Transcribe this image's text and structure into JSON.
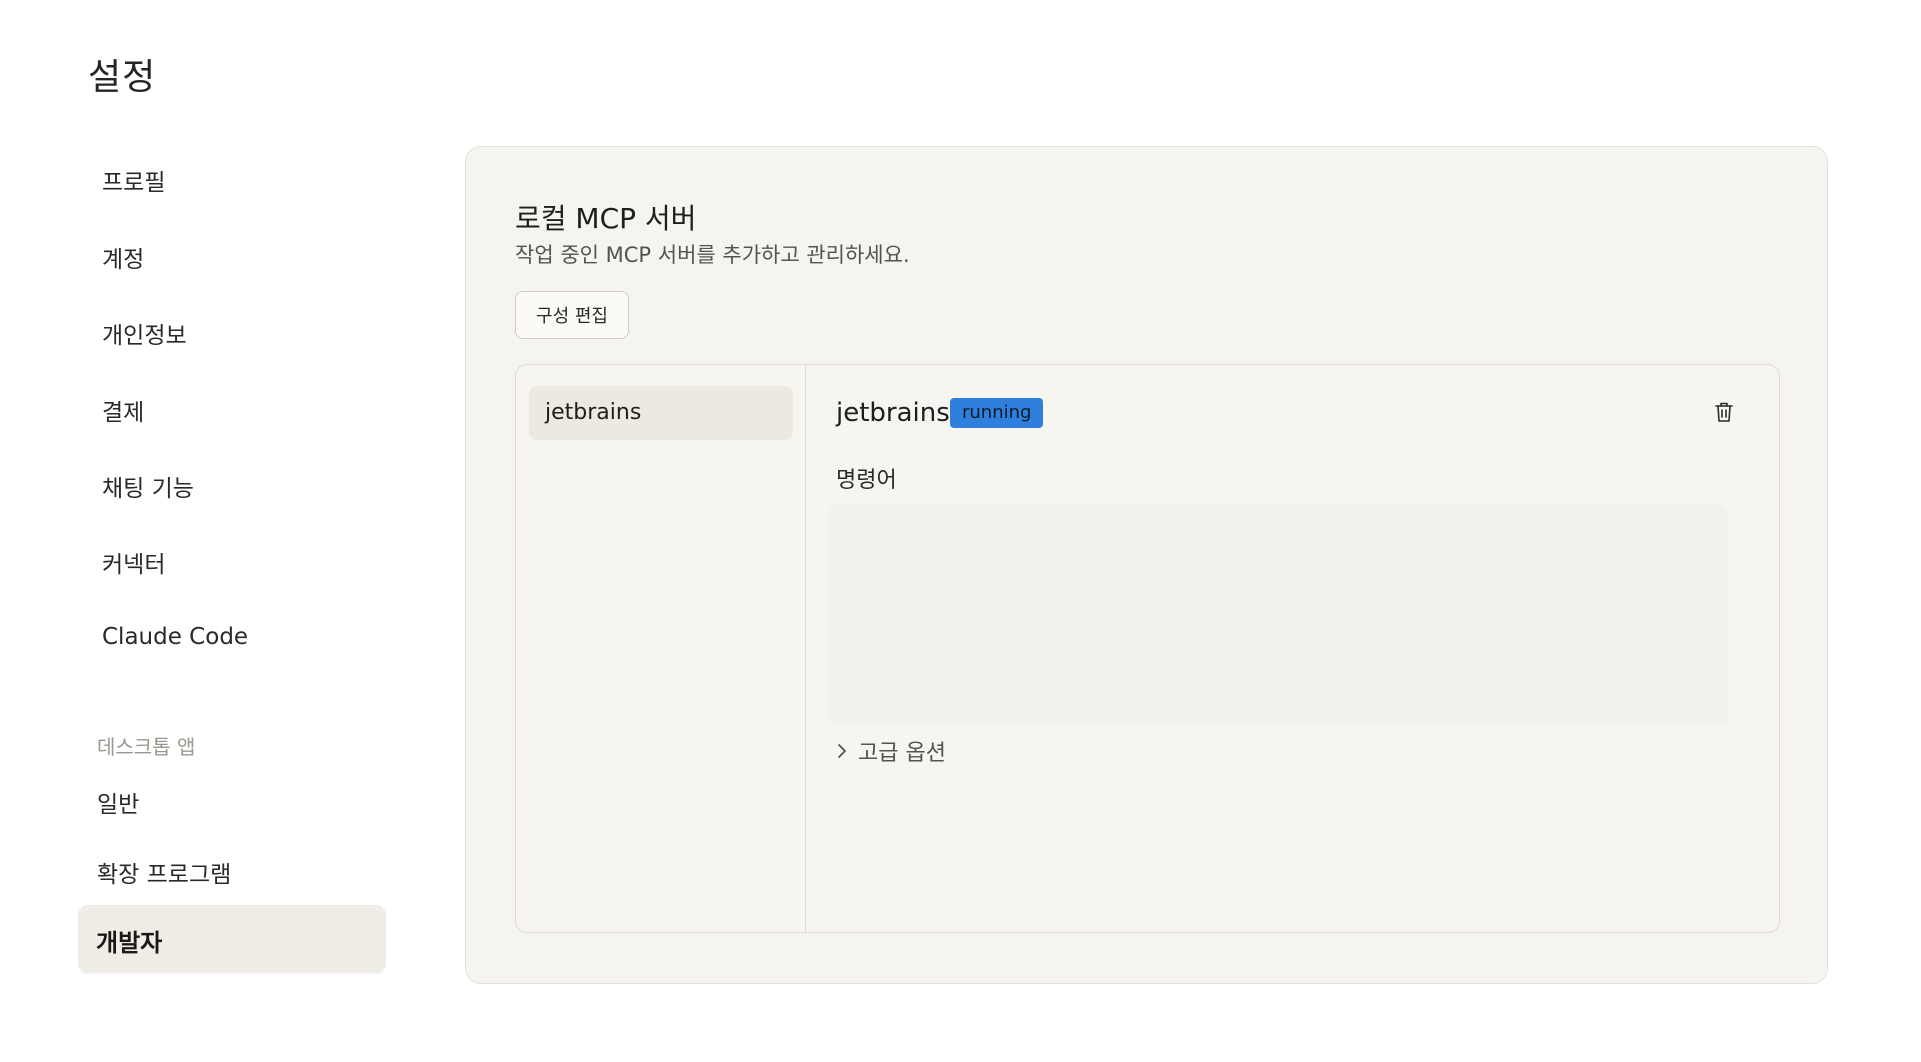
{
  "page": {
    "title": "설정"
  },
  "sidebar": {
    "items": [
      {
        "label": "프로필"
      },
      {
        "label": "계정"
      },
      {
        "label": "개인정보"
      },
      {
        "label": "결제"
      },
      {
        "label": "채팅 기능"
      },
      {
        "label": "커넥터"
      },
      {
        "label": "Claude Code"
      }
    ],
    "section_label": "데스크톱 앱",
    "app_items": [
      {
        "label": "일반"
      },
      {
        "label": "확장 프로그램"
      },
      {
        "label": "개발자",
        "active": true
      }
    ]
  },
  "main": {
    "title": "로컬 MCP 서버",
    "subtitle": "작업 중인 MCP 서버를 추가하고 관리하세요.",
    "edit_config_label": "구성 편집",
    "servers": [
      {
        "name": "jetbrains"
      }
    ],
    "selected_server": {
      "name": "jetbrains",
      "status": "running",
      "command_label": "명령어",
      "advanced_label": "고급 옵션"
    }
  },
  "colors": {
    "status_running": "#2f7fdc",
    "active_nav_bg": "#f0ede6",
    "card_bg": "#f6f4ef"
  },
  "icons": {
    "delete": "trash-icon",
    "expand": "chevron-right-icon"
  }
}
